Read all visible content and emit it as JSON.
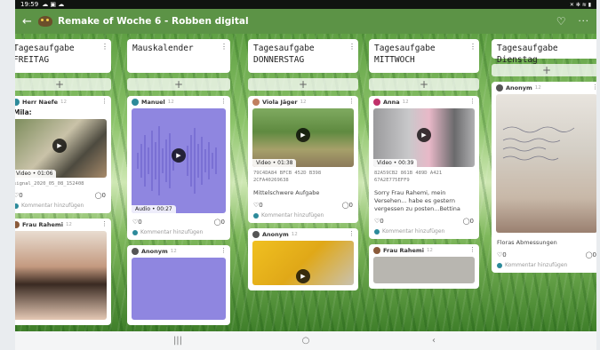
{
  "status": {
    "time": "19:59",
    "left_icons": "☁ ▣ ☁",
    "right_icons": "✕ ✻ ≋ ▮"
  },
  "appbar": {
    "title": "Remake of Woche 6 - Robben digital",
    "back_icon": "arrow-left",
    "heart_icon": "heart-outline",
    "more_icon": "more-dots"
  },
  "columns": [
    {
      "title1": "Tagesaufgabe",
      "title2": "FREITAG",
      "cards": [
        {
          "author": "Herr Naefe",
          "time": "12",
          "title": "Mila:",
          "badge": "Video • 01:06",
          "filename": "signal_2020_05_08_152408",
          "likes": "0",
          "comments": "0",
          "comment_placeholder": "Kommentar hinzufügen"
        },
        {
          "author": "Frau Rahemi",
          "time": "12"
        }
      ]
    },
    {
      "title1": "Mauskalender",
      "title2": "",
      "cards": [
        {
          "author": "Manuel",
          "time": "12",
          "badge": "Audio • 00:27",
          "likes": "0",
          "comments": "0",
          "comment_placeholder": "Kommentar hinzufügen"
        },
        {
          "author": "Anonym",
          "time": "12"
        }
      ]
    },
    {
      "title1": "Tagesaufgabe",
      "title2": "DONNERSTAG",
      "cards": [
        {
          "author": "Viola Jäger",
          "time": "12",
          "badge": "Video • 01:38",
          "code": "79C4DA84 BFCB 452D B398 2CFA40269638",
          "text": "Mittelschwere Aufgabe",
          "likes": "0",
          "comments": "0",
          "comment_placeholder": "Kommentar hinzufügen"
        },
        {
          "author": "Anonym",
          "time": "12"
        }
      ]
    },
    {
      "title1": "Tagesaufgabe",
      "title2": "MITTWOCH",
      "cards": [
        {
          "author": "Anna",
          "time": "12",
          "badge": "Video • 00:39",
          "code": "82A59CB2 861B 489D A421 67A2E775EFF9",
          "text": "Sorry Frau Rahemi, mein Versehen... habe es gestern vergessen zu posten...Bettina",
          "likes": "0",
          "comments": "0",
          "comment_placeholder": "Kommentar hinzufügen"
        },
        {
          "author": "Frau Rahemi",
          "time": "12"
        }
      ]
    },
    {
      "title1": "Tagesaufgabe Dienstag",
      "title2": "",
      "cards": [
        {
          "author": "Anonym",
          "time": "12",
          "text": "Floras Abmessungen",
          "likes": "0",
          "comments": "0",
          "comment_placeholder": "Kommentar hinzufügen"
        }
      ]
    }
  ],
  "add_label": "+",
  "navbar": {
    "recents": "|||",
    "home": "○",
    "back": "‹"
  }
}
